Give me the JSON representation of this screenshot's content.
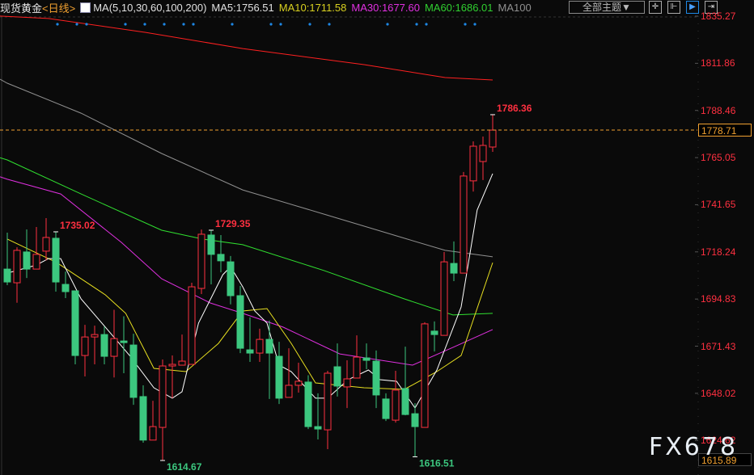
{
  "header": {
    "symbol": "现货黄金",
    "period": "<日线>",
    "ma_params": "MA(5,10,30,60,100,200)",
    "ma5": "MA5:1756.51",
    "ma10": "MA10:1711.58",
    "ma30": "MA30:1677.60",
    "ma60": "MA60:1686.01",
    "ma100": "MA100",
    "theme_select": "全部主题▼"
  },
  "toolbar": {
    "icons": [
      "crosshair-icon",
      "fit-range-icon",
      "play-icon",
      "exit-icon"
    ]
  },
  "colors": {
    "up": "#ff3040",
    "down": "#3cc77f",
    "ma5": "#ffffff",
    "ma10": "#e8e020",
    "ma30": "#e030e0",
    "ma60": "#30e030",
    "ma100": "#909090",
    "ma200": "#ff2020",
    "current": "#f0a030",
    "marker": "#1e88e5"
  },
  "watermark": "FX678",
  "chart_data": {
    "type": "candlestick",
    "title": "现货黄金 日线",
    "ylim": [
      1615.89,
      1835.27
    ],
    "y_ticks": [
      "1835.27",
      "1811.86",
      "1788.46",
      "1765.05",
      "1741.65",
      "1718.24",
      "1694.83",
      "1671.43",
      "1648.02",
      "1624.62"
    ],
    "y_min_label": "1615.89",
    "current_price": "1778.71",
    "annotations": [
      {
        "index": 5,
        "text": "1735.02",
        "type": "high"
      },
      {
        "index": 21,
        "text": "1729.35",
        "type": "high"
      },
      {
        "index": 50,
        "text": "1786.36",
        "type": "high"
      },
      {
        "index": 16,
        "text": "1614.67",
        "type": "low"
      },
      {
        "index": 42,
        "text": "1616.51",
        "type": "low"
      }
    ],
    "marker_indices": [
      5,
      7,
      8,
      12,
      14,
      16,
      18,
      19,
      23,
      27,
      28,
      31,
      33,
      39,
      42,
      43,
      47,
      48
    ],
    "ohlc": [
      [
        1709.7,
        1727.8,
        1701.7,
        1703.3
      ],
      [
        1702.9,
        1720.5,
        1693.0,
        1719.0
      ],
      [
        1718.2,
        1729.4,
        1705.3,
        1709.7
      ],
      [
        1709.7,
        1730.6,
        1709.7,
        1717.0
      ],
      [
        1718.6,
        1735.02,
        1714.0,
        1725.4
      ],
      [
        1725.0,
        1728.2,
        1698.5,
        1703.3
      ],
      [
        1702.1,
        1708.5,
        1695.3,
        1698.5
      ],
      [
        1698.9,
        1698.9,
        1662.4,
        1666.8
      ],
      [
        1666.8,
        1682.0,
        1656.4,
        1676.0
      ],
      [
        1676.0,
        1681.6,
        1662.4,
        1677.2
      ],
      [
        1677.2,
        1681.2,
        1662.4,
        1666.4
      ],
      [
        1666.4,
        1689.5,
        1655.9,
        1675.2
      ],
      [
        1674.0,
        1686.3,
        1658.0,
        1673.2
      ],
      [
        1672.0,
        1677.6,
        1642.3,
        1646.0
      ],
      [
        1646.4,
        1652.0,
        1623.5,
        1624.8
      ],
      [
        1624.8,
        1644.3,
        1624.8,
        1631.5
      ],
      [
        1631.1,
        1664.8,
        1614.67,
        1661.6
      ],
      [
        1661.6,
        1666.8,
        1645.6,
        1662.4
      ],
      [
        1662.0,
        1677.2,
        1662.0,
        1664.0
      ],
      [
        1662.4,
        1702.9,
        1662.4,
        1700.9
      ],
      [
        1700.1,
        1729.35,
        1697.3,
        1727.0
      ],
      [
        1726.6,
        1729.0,
        1702.1,
        1717.0
      ],
      [
        1717.0,
        1726.6,
        1708.1,
        1713.8
      ],
      [
        1713.3,
        1716.2,
        1692.2,
        1696.5
      ],
      [
        1696.5,
        1701.3,
        1668.0,
        1670.4
      ],
      [
        1669.6,
        1685.7,
        1663.6,
        1668.0
      ],
      [
        1668.0,
        1680.1,
        1663.6,
        1674.8
      ],
      [
        1674.8,
        1684.1,
        1645.2,
        1668.0
      ],
      [
        1666.4,
        1673.6,
        1642.7,
        1645.6
      ],
      [
        1646.0,
        1670.4,
        1646.0,
        1652.0
      ],
      [
        1652.0,
        1663.2,
        1648.4,
        1654.0
      ],
      [
        1653.6,
        1657.0,
        1630.3,
        1631.5
      ],
      [
        1631.5,
        1648.0,
        1625.1,
        1630.3
      ],
      [
        1629.9,
        1659.2,
        1620.3,
        1658.0
      ],
      [
        1661.2,
        1672.8,
        1646.4,
        1651.6
      ],
      [
        1651.2,
        1664.4,
        1640.7,
        1655.2
      ],
      [
        1655.6,
        1676.8,
        1655.6,
        1666.0
      ],
      [
        1665.6,
        1672.8,
        1660.0,
        1664.4
      ],
      [
        1664.0,
        1669.3,
        1640.7,
        1647.2
      ],
      [
        1645.2,
        1648.0,
        1634.3,
        1635.5
      ],
      [
        1634.7,
        1659.2,
        1633.5,
        1649.6
      ],
      [
        1650.4,
        1671.2,
        1637.1,
        1637.5
      ],
      [
        1637.9,
        1643.1,
        1616.51,
        1631.5
      ],
      [
        1631.1,
        1683.3,
        1631.1,
        1682.5
      ],
      [
        1678.9,
        1683.7,
        1668.8,
        1677.2
      ],
      [
        1676.8,
        1718.2,
        1676.8,
        1713.3
      ],
      [
        1712.5,
        1723.4,
        1703.7,
        1707.7
      ],
      [
        1707.7,
        1757.9,
        1707.7,
        1755.9
      ],
      [
        1753.5,
        1773.1,
        1748.2,
        1770.7
      ],
      [
        1763.1,
        1775.5,
        1753.9,
        1771.1
      ],
      [
        1770.3,
        1786.36,
        1767.9,
        1778.7
      ]
    ],
    "series": [
      {
        "name": "MA200",
        "color_key": "ma200",
        "points": [
          [
            -0.75,
            1835.3
          ],
          [
            4.25,
            1834.1
          ],
          [
            14.25,
            1827.2
          ],
          [
            24.25,
            1819.2
          ],
          [
            36.75,
            1811.2
          ],
          [
            45.1,
            1804.8
          ],
          [
            50,
            1803.6
          ]
        ]
      },
      {
        "name": "MA100",
        "color_key": "ma100",
        "points": [
          [
            -0.75,
            1804
          ],
          [
            0,
            1802.0
          ],
          [
            7.6,
            1787.1
          ],
          [
            15.9,
            1767.1
          ],
          [
            24.25,
            1749.0
          ],
          [
            32.6,
            1737.0
          ],
          [
            40.9,
            1725.0
          ],
          [
            45.1,
            1719.0
          ],
          [
            50,
            1715.8
          ]
        ]
      },
      {
        "name": "MA60",
        "color_key": "ma60",
        "points": [
          [
            -0.75,
            1765
          ],
          [
            0,
            1763.9
          ],
          [
            7.6,
            1747.0
          ],
          [
            15.9,
            1729.0
          ],
          [
            20.1,
            1724.6
          ],
          [
            24.25,
            1721.8
          ],
          [
            32.6,
            1709.0
          ],
          [
            40.9,
            1694.9
          ],
          [
            45.9,
            1686.9
          ],
          [
            50,
            1687.7
          ]
        ]
      },
      {
        "name": "MA30",
        "color_key": "ma30",
        "points": [
          [
            -0.75,
            1755.5
          ],
          [
            0,
            1754.3
          ],
          [
            5.5,
            1747.0
          ],
          [
            11.75,
            1722.97
          ],
          [
            15.9,
            1704.9
          ],
          [
            20.9,
            1692.9
          ],
          [
            24.25,
            1687.7
          ],
          [
            28.4,
            1680.9
          ],
          [
            34.25,
            1667.6
          ],
          [
            41.75,
            1662.0
          ],
          [
            45.9,
            1670.8
          ],
          [
            50,
            1679.7
          ]
        ]
      },
      {
        "name": "MA10",
        "color_key": "ma10",
        "points": [
          [
            0,
            1724.6
          ],
          [
            5.1,
            1712.9
          ],
          [
            10.1,
            1696.9
          ],
          [
            12.2,
            1687.7
          ],
          [
            15.1,
            1660.4
          ],
          [
            18.4,
            1658.8
          ],
          [
            21.75,
            1672.8
          ],
          [
            24.25,
            1688.9
          ],
          [
            26.75,
            1690.1
          ],
          [
            29.25,
            1672.8
          ],
          [
            31.75,
            1653.2
          ],
          [
            36.75,
            1650.8
          ],
          [
            40.9,
            1650.0
          ],
          [
            44.25,
            1658.8
          ],
          [
            46.75,
            1666.8
          ],
          [
            50,
            1712.9
          ]
        ]
      },
      {
        "name": "MA5",
        "color_key": "ma5",
        "points": [
          [
            0,
            1707.7
          ],
          [
            3,
            1711.7
          ],
          [
            4.25,
            1714.9
          ],
          [
            5.5,
            1714.9
          ],
          [
            7.6,
            1694.9
          ],
          [
            10.1,
            1680.9
          ],
          [
            12.6,
            1666.8
          ],
          [
            15.1,
            1650.8
          ],
          [
            17,
            1645.6
          ],
          [
            18,
            1648.8
          ],
          [
            19.7,
            1682.9
          ],
          [
            22.2,
            1706.9
          ],
          [
            23,
            1710.9
          ],
          [
            24.25,
            1700.9
          ],
          [
            25.5,
            1688.9
          ],
          [
            26.75,
            1682.9
          ],
          [
            28,
            1662.0
          ],
          [
            29.25,
            1658.8
          ],
          [
            31.75,
            1645.6
          ],
          [
            33,
            1645.6
          ],
          [
            35.1,
            1654.8
          ],
          [
            37.2,
            1659.6
          ],
          [
            38.4,
            1654.8
          ],
          [
            40.1,
            1654.0
          ],
          [
            42,
            1640.7
          ],
          [
            44.25,
            1659.6
          ],
          [
            46.75,
            1690.9
          ],
          [
            48.4,
            1739.0
          ],
          [
            50,
            1757.1
          ]
        ]
      }
    ]
  }
}
